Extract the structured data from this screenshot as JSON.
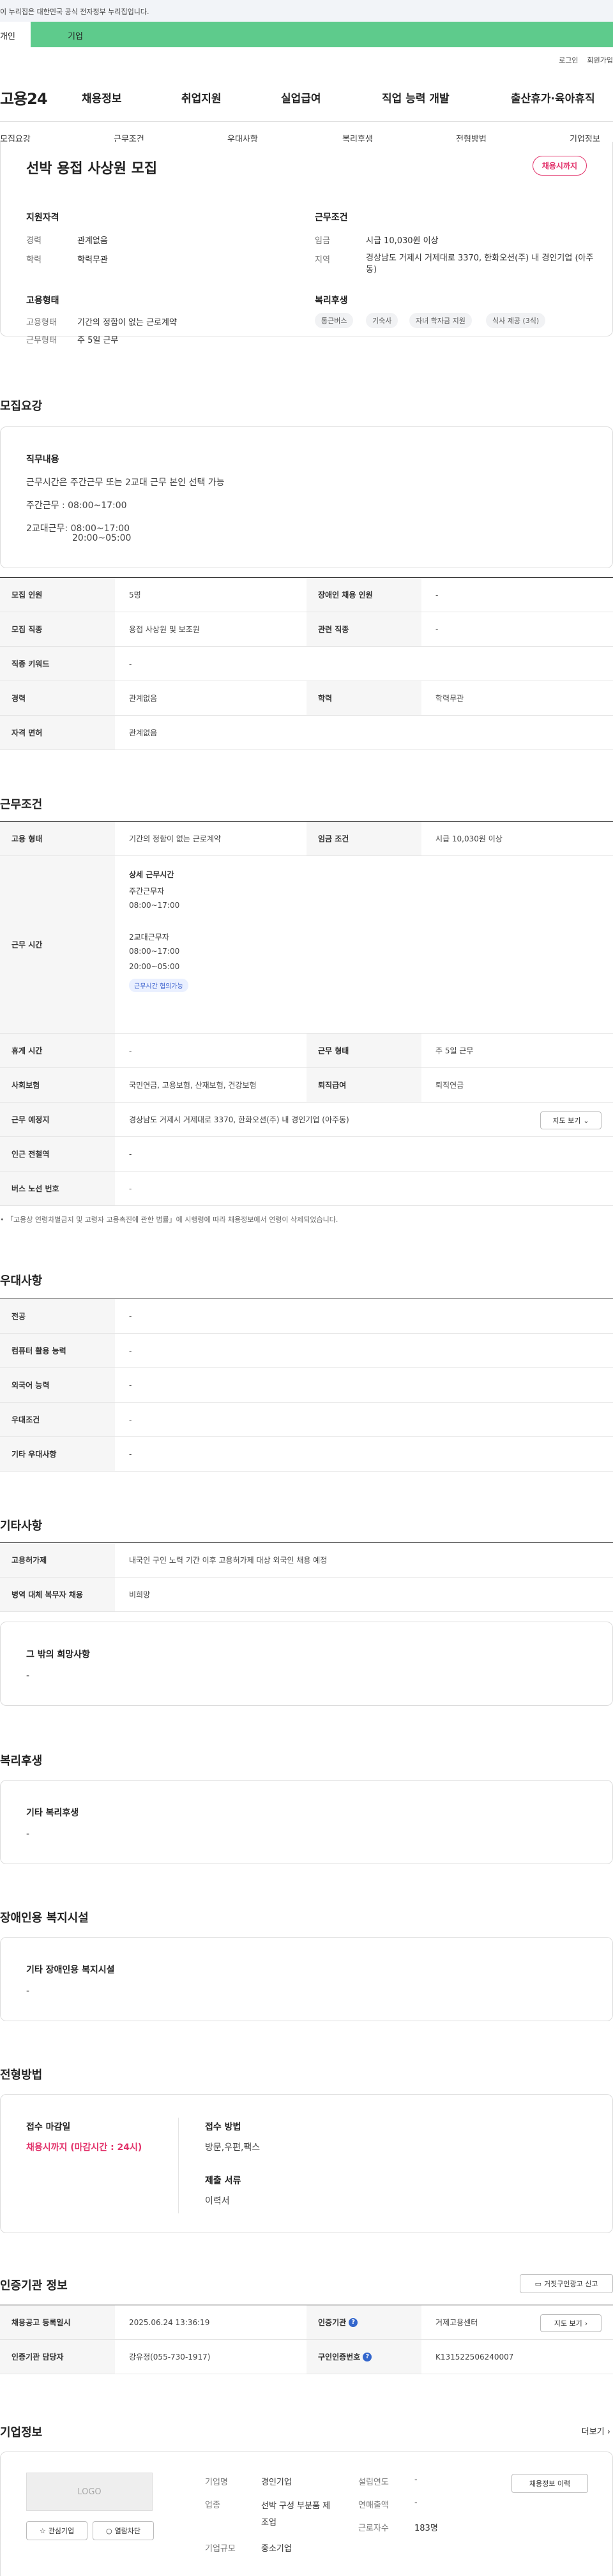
{
  "gov_notice": "이 누리집은 대한민국 공식 전자정부 누리집입니다.",
  "topbar": {
    "left_tab": "개인",
    "right_tab": "기업"
  },
  "util": {
    "login": "로그인",
    "signup": "회원가입"
  },
  "gnb": {
    "logo": "고용24",
    "menu": [
      "채용정보",
      "취업지원",
      "실업급여",
      "직업 능력 개발",
      "출산휴가·육아휴직"
    ]
  },
  "subnav": [
    "모집요강",
    "근무조건",
    "우대사항",
    "복리후생",
    "전형방법",
    "기업정보"
  ],
  "header": {
    "title": "선박 용접 사상원 모집",
    "badge": "채용시까지",
    "qual_title": "지원자격",
    "cond_title": "근무조건",
    "qual": [
      {
        "k": "경력",
        "v": "관계없음"
      },
      {
        "k": "학력",
        "v": "학력무관"
      }
    ],
    "cond": [
      {
        "k": "임금",
        "v": "시급 10,030원 이상"
      },
      {
        "k": "지역",
        "v": "경상남도 거제시 거제대로 3370, 한화오션(주) 내 경인기업 (아주동)"
      }
    ],
    "emp_title": "고용형태",
    "emp": [
      {
        "k": "고용형태",
        "v": "기간의 정함이 없는 근로계약"
      },
      {
        "k": "근무형태",
        "v": "주 5일 근무"
      }
    ],
    "welfare_title": "복리후생",
    "welfare_chips": [
      "통근버스",
      "기숙사",
      "자녀 학자금 지원",
      "식사 제공 (3식)"
    ]
  },
  "recruit": {
    "section": "모집요강",
    "duty_title": "직무내용",
    "duty_lines": [
      "근무시간은 주간근무 또는 2교대 근무 본인 선택 가능",
      "주간근무 : 08:00~17:00",
      "2교대근무: 08:00~17:00",
      "20:00~05:00"
    ],
    "rows": [
      {
        "k1": "모집 인원",
        "v1": "5명",
        "k2": "장애인 채용 인원",
        "v2": "-"
      },
      {
        "k1": "모집 직종",
        "v1": "용접 사상원 및 보조원",
        "k2": "관련 직종",
        "v2": "-"
      },
      {
        "k1": "직종 키워드",
        "v1": "-",
        "k2": "",
        "v2": ""
      },
      {
        "k1": "경력",
        "v1": "관계없음",
        "k2": "학력",
        "v2": "학력무관"
      },
      {
        "k1": "자격 면허",
        "v1": "관계없음",
        "k2": "",
        "v2": ""
      }
    ]
  },
  "work": {
    "section": "근무조건",
    "r1": {
      "k1": "고용 형태",
      "v1": "기간의 정함이 없는 근로계약",
      "k2": "임금 조건",
      "v2": "시급 10,030원 이상"
    },
    "hours_key": "근무 시간",
    "hours_title": "상세 근무시간",
    "hours_lines": [
      "주간근무자",
      "08:00~17:00",
      "",
      "2교대근무자",
      "08:00~17:00",
      "20:00~05:00"
    ],
    "hours_tag": "근무시간 협의가능",
    "r3": {
      "k1": "휴게 시간",
      "v1": "-",
      "k2": "근무 형태",
      "v2": "주 5일 근무"
    },
    "r4": {
      "k1": "사회보험",
      "v1": "국민연금, 고용보험, 산재보험, 건강보험",
      "k2": "퇴직급여",
      "v2": "퇴직연금"
    },
    "r5": {
      "k": "근무 예정지",
      "v": "경상남도 거제시 거제대로 3370, 한화오션(주) 내 경인기업 (아주동)",
      "btn": "지도 보기"
    },
    "r6": {
      "k": "인근 전철역",
      "v": "-"
    },
    "r7": {
      "k": "버스 노선 번호",
      "v": "-"
    },
    "note": "「고용상 연령차별금지 및 고령자 고용촉진에 관한 법률」에 시행령에 따라 채용정보에서 연령이 삭제되었습니다."
  },
  "pref": {
    "section": "우대사항",
    "rows": [
      {
        "k": "전공",
        "v": "-"
      },
      {
        "k": "컴퓨터 활용 능력",
        "v": "-"
      },
      {
        "k": "외국어 능력",
        "v": "-"
      },
      {
        "k": "우대조건",
        "v": "-"
      },
      {
        "k": "기타 우대사항",
        "v": "-"
      }
    ]
  },
  "etc": {
    "section": "기타사항",
    "rows": [
      {
        "k": "고용허가제",
        "v": "내국인 구인 노력 기간 이후 고용허가제 대상 외국인 채용 예정"
      },
      {
        "k": "병역 대체 복무자 채용",
        "v": "비희망"
      }
    ],
    "card_title": "그 밖의 희망사항",
    "card_value": "-"
  },
  "welfare": {
    "section": "복리후생",
    "card_title": "기타 복리후생",
    "card_value": "-"
  },
  "disabled": {
    "section": "장애인용 복지시설",
    "card_title": "기타 장애인용 복지시설",
    "card_value": "-"
  },
  "selection": {
    "section": "전형방법",
    "deadline_title": "접수 마감일",
    "deadline_value": "채용시까지 (마감시간 : 24시)",
    "method_title": "접수 방법",
    "method_value": "방문,우편,팩스",
    "docs_title": "제출 서류",
    "docs_value": "이력서"
  },
  "cert": {
    "section": "인증기관 정보",
    "report_btn": "거짓구인광고 신고",
    "r1": {
      "k1": "채용공고 등록일시",
      "v1": "2025.06.24 13:36:19",
      "k2": "인증기관",
      "v2": "거제고용센터",
      "btn": "지도 보기"
    },
    "r2": {
      "k1": "인증기관 담당자",
      "v1": "강유정(055-730-1917)",
      "k2": "구인인증번호",
      "v2": "K131522506240007"
    }
  },
  "company": {
    "section": "기업정보",
    "more": "더보기",
    "logo_text": "LOGO",
    "interest_btn": "관심기업",
    "block_btn": "열람차단",
    "fields": [
      {
        "k": "기업명",
        "v": "경인기업"
      },
      {
        "k": "업종",
        "v": "선박 구성 부분품 제조업"
      },
      {
        "k": "기업규모",
        "v": "중소기업"
      }
    ],
    "fields2": [
      {
        "k": "설립연도",
        "v": "-"
      },
      {
        "k": "연매출액",
        "v": "-"
      },
      {
        "k": "근로자수",
        "v": "183명"
      }
    ],
    "history_btn": "채용정보 이력"
  }
}
